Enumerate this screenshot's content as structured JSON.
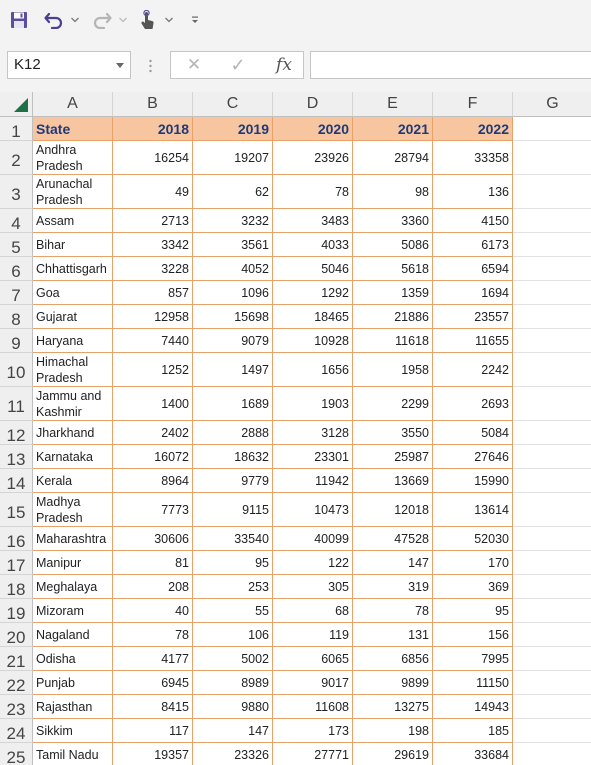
{
  "toolbar": {
    "icons": [
      "save-icon",
      "undo-icon",
      "redo-icon",
      "touch-mode-icon",
      "customize-icon"
    ]
  },
  "formula_bar": {
    "name_box": "K12",
    "cancel_glyph": "✕",
    "enter_glyph": "✓",
    "fx_label": "fx",
    "formula": ""
  },
  "sheet": {
    "columns": [
      "A",
      "B",
      "C",
      "D",
      "E",
      "F",
      "G"
    ],
    "row_numbers": [
      "1",
      "2",
      "3",
      "4",
      "5",
      "6",
      "7",
      "8",
      "9",
      "10",
      "11",
      "12",
      "13",
      "14",
      "15",
      "16",
      "17",
      "18",
      "19",
      "20",
      "21",
      "22",
      "23",
      "24",
      "25"
    ],
    "header": [
      "State",
      "2018",
      "2019",
      "2020",
      "2021",
      "2022"
    ],
    "rows": [
      {
        "state": "Andhra Pradesh",
        "values": [
          "16254",
          "19207",
          "23926",
          "28794",
          "33358"
        ]
      },
      {
        "state": "Arunachal Pradesh",
        "values": [
          "49",
          "62",
          "78",
          "98",
          "136"
        ]
      },
      {
        "state": "Assam",
        "values": [
          "2713",
          "3232",
          "3483",
          "3360",
          "4150"
        ]
      },
      {
        "state": "Bihar",
        "values": [
          "3342",
          "3561",
          "4033",
          "5086",
          "6173"
        ]
      },
      {
        "state": "Chhattisgarh",
        "values": [
          "3228",
          "4052",
          "5046",
          "5618",
          "6594"
        ]
      },
      {
        "state": "Goa",
        "values": [
          "857",
          "1096",
          "1292",
          "1359",
          "1694"
        ]
      },
      {
        "state": "Gujarat",
        "values": [
          "12958",
          "15698",
          "18465",
          "21886",
          "23557"
        ]
      },
      {
        "state": "Haryana",
        "values": [
          "7440",
          "9079",
          "10928",
          "11618",
          "11655"
        ]
      },
      {
        "state": "Himachal Pradesh",
        "values": [
          "1252",
          "1497",
          "1656",
          "1958",
          "2242"
        ]
      },
      {
        "state": "Jammu and Kashmir",
        "values": [
          "1400",
          "1689",
          "1903",
          "2299",
          "2693"
        ]
      },
      {
        "state": "Jharkhand",
        "values": [
          "2402",
          "2888",
          "3128",
          "3550",
          "5084"
        ]
      },
      {
        "state": "Karnataka",
        "values": [
          "16072",
          "18632",
          "23301",
          "25987",
          "27646"
        ]
      },
      {
        "state": "Kerala",
        "values": [
          "8964",
          "9779",
          "11942",
          "13669",
          "15990"
        ]
      },
      {
        "state": "Madhya Pradesh",
        "values": [
          "7773",
          "9115",
          "10473",
          "12018",
          "13614"
        ]
      },
      {
        "state": "Maharashtra",
        "values": [
          "30606",
          "33540",
          "40099",
          "47528",
          "52030"
        ]
      },
      {
        "state": "Manipur",
        "values": [
          "81",
          "95",
          "122",
          "147",
          "170"
        ]
      },
      {
        "state": "Meghalaya",
        "values": [
          "208",
          "253",
          "305",
          "319",
          "369"
        ]
      },
      {
        "state": "Mizoram",
        "values": [
          "40",
          "55",
          "68",
          "78",
          "95"
        ]
      },
      {
        "state": "Nagaland",
        "values": [
          "78",
          "106",
          "119",
          "131",
          "156"
        ]
      },
      {
        "state": "Odisha",
        "values": [
          "4177",
          "5002",
          "6065",
          "6856",
          "7995"
        ]
      },
      {
        "state": "Punjab",
        "values": [
          "6945",
          "8989",
          "9017",
          "9899",
          "11150"
        ]
      },
      {
        "state": "Rajasthan",
        "values": [
          "8415",
          "9880",
          "11608",
          "13275",
          "14943"
        ]
      },
      {
        "state": "Sikkim",
        "values": [
          "117",
          "147",
          "173",
          "198",
          "185"
        ]
      },
      {
        "state": "Tamil Nadu",
        "values": [
          "19357",
          "23326",
          "27771",
          "29619",
          "33684"
        ]
      }
    ]
  },
  "colors": {
    "header_fill": "#f7c6a0",
    "header_text": "#1f3a78",
    "border": "#e8a268",
    "excel_green": "#1e7145"
  }
}
